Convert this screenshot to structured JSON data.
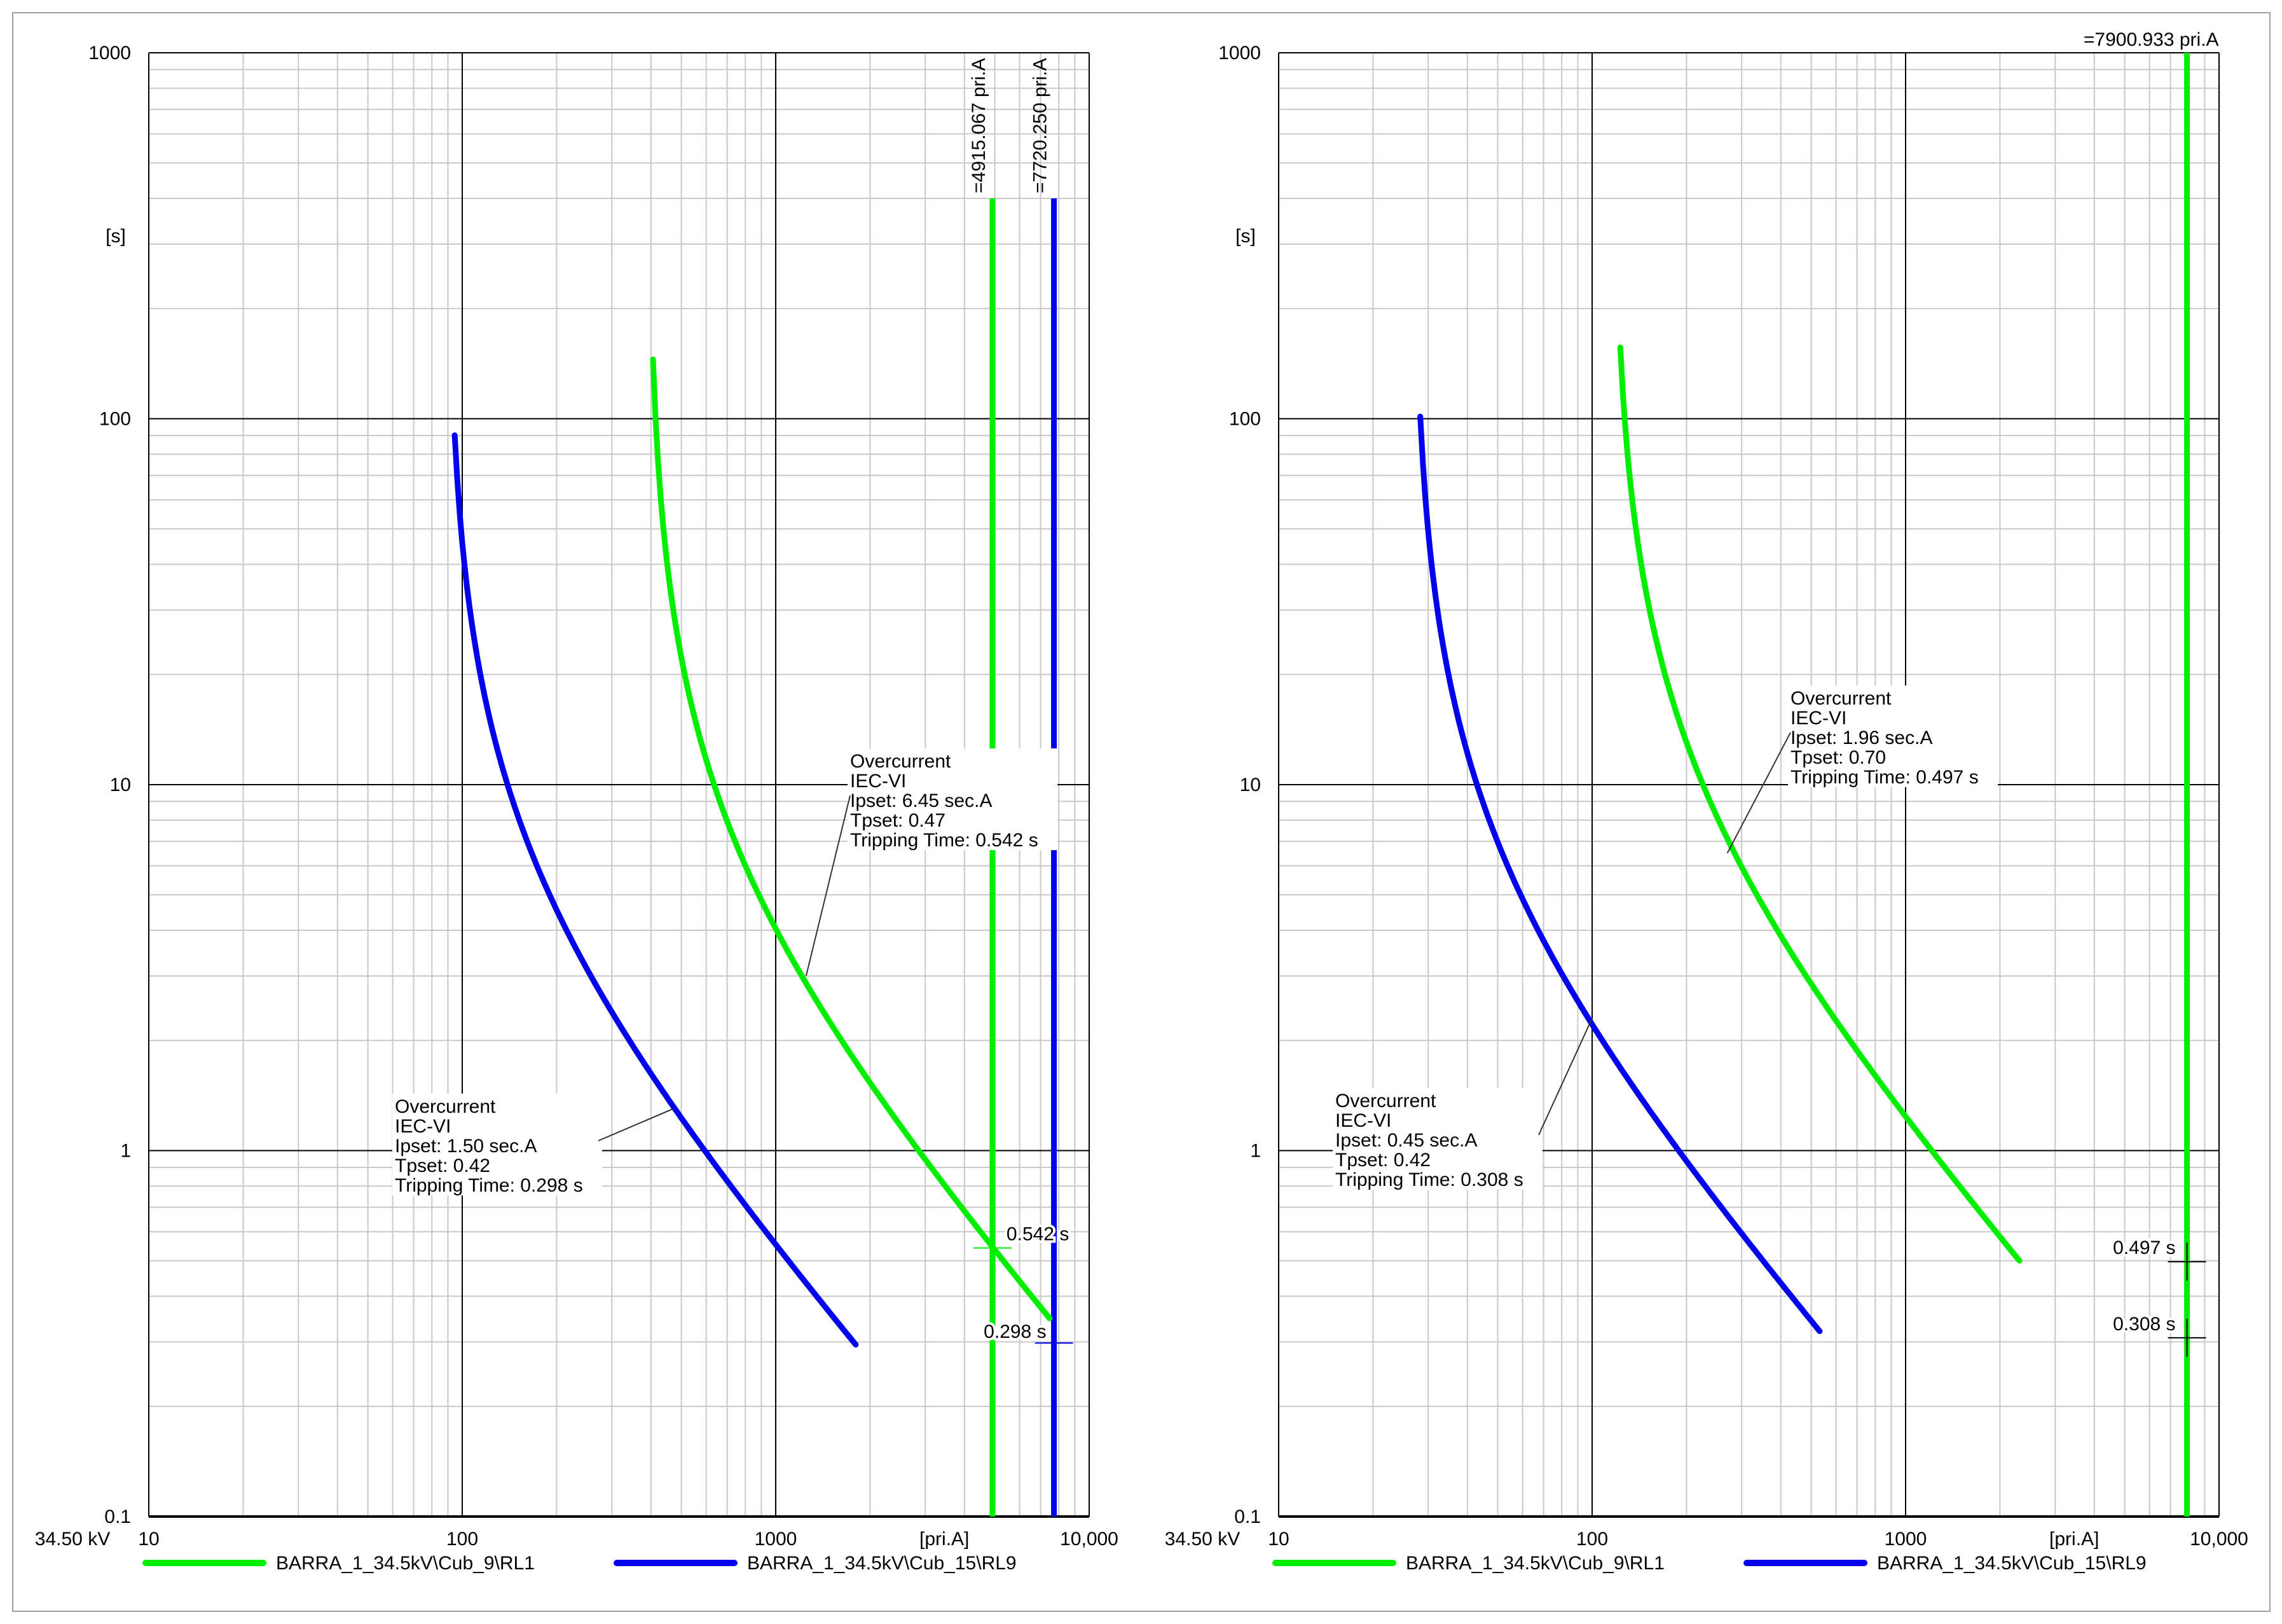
{
  "colors": {
    "green": "#00ee00",
    "blue": "#0000ee",
    "grid_minor": "#c8c8c8",
    "grid_major": "#000000"
  },
  "chart_data": [
    {
      "type": "line",
      "xscale": "log",
      "yscale": "log",
      "xlim": [
        10,
        10000
      ],
      "ylim": [
        0.1,
        1000
      ],
      "xticks": [
        "10",
        "100",
        "1000",
        "10,000"
      ],
      "yticks": [
        "0.1",
        "1",
        "10",
        "100",
        "1000"
      ],
      "xlabel": "[pri.A]",
      "ylabel": "[s]",
      "voltage_label": "34.50 kV",
      "grid": true,
      "series": [
        {
          "name": "BARRA_1_34.5kV\\Cub_9\\RL1",
          "color": "green",
          "curve": "IEC-VI",
          "pickup_priA": 389,
          "tms": 0.47,
          "i_range": [
            406,
            7480
          ]
        },
        {
          "name": "BARRA_1_34.5kV\\Cub_15\\RL9",
          "color": "blue",
          "curve": "IEC-VI",
          "pickup_priA": 89,
          "tms": 0.42,
          "i_range": [
            94.6,
            1800
          ]
        }
      ],
      "vertical_lines": [
        {
          "value": 4915.067,
          "label": "=4915.067 pri.A",
          "color": "green",
          "t_top": 400
        },
        {
          "value": 7720.25,
          "label": "=7720.250 pri.A",
          "color": "blue",
          "t_top": 400
        }
      ],
      "time_markers": [
        {
          "i": 4915.067,
          "t": 0.542,
          "label": "0.542 s",
          "color": "green"
        },
        {
          "i": 7720.25,
          "t": 0.298,
          "label": "0.298 s",
          "color": "blue"
        }
      ],
      "annotations": [
        {
          "lines": [
            "Overcurrent",
            "IEC-VI",
            "Ipset: 6.45 sec.A",
            "Tpset: 0.47",
            "Tripping Time: 0.542 s"
          ],
          "anchor_i": 1250,
          "anchor_t": 3.0
        },
        {
          "lines": [
            "Overcurrent",
            "IEC-VI",
            "Ipset: 1.50 sec.A",
            "Tpset: 0.42",
            "Tripping Time: 0.298 s"
          ],
          "anchor_i": 470,
          "anchor_t": 1.3
        }
      ]
    },
    {
      "type": "line",
      "xscale": "log",
      "yscale": "log",
      "xlim": [
        10,
        10000
      ],
      "ylim": [
        0.1,
        1000
      ],
      "xticks": [
        "10",
        "100",
        "1000",
        "10,000"
      ],
      "yticks": [
        "0.1",
        "1",
        "10",
        "100",
        "1000"
      ],
      "xlabel": "[pri.A]",
      "ylabel": "[s]",
      "voltage_label": "34.50 kV",
      "grid": true,
      "series": [
        {
          "name": "BARRA_1_34.5kV\\Cub_9\\RL1",
          "color": "green",
          "curve": "IEC-VI",
          "pickup_priA": 116,
          "tms": 0.7,
          "i_range": [
            123,
            2307
          ]
        },
        {
          "name": "BARRA_1_34.5kV\\Cub_15\\RL9",
          "color": "blue",
          "curve": "IEC-VI",
          "pickup_priA": 26.7,
          "tms": 0.45,
          "i_range": [
            28.3,
            532
          ]
        }
      ],
      "vertical_lines": [
        {
          "value": 7900.933,
          "label": "=7900.933 pri.A",
          "color": "green",
          "t_top": 1000
        }
      ],
      "time_markers": [
        {
          "i": 7900.933,
          "t": 0.497,
          "label": "0.497 s",
          "color": "black"
        },
        {
          "i": 7900.933,
          "t": 0.308,
          "label": "0.308 s",
          "color": "black"
        }
      ],
      "annotations": [
        {
          "lines": [
            "Overcurrent",
            "IEC-VI",
            "Ipset: 1.96 sec.A",
            "Tpset: 0.70",
            "Tripping Time: 0.497 s"
          ],
          "anchor_i": 270,
          "anchor_t": 6.5
        },
        {
          "lines": [
            "Overcurrent",
            "IEC-VI",
            "Ipset: 0.45 sec.A",
            "Tpset: 0.42",
            "Tripping Time: 0.308 s"
          ],
          "anchor_i": 100,
          "anchor_t": 2.3
        }
      ]
    }
  ]
}
